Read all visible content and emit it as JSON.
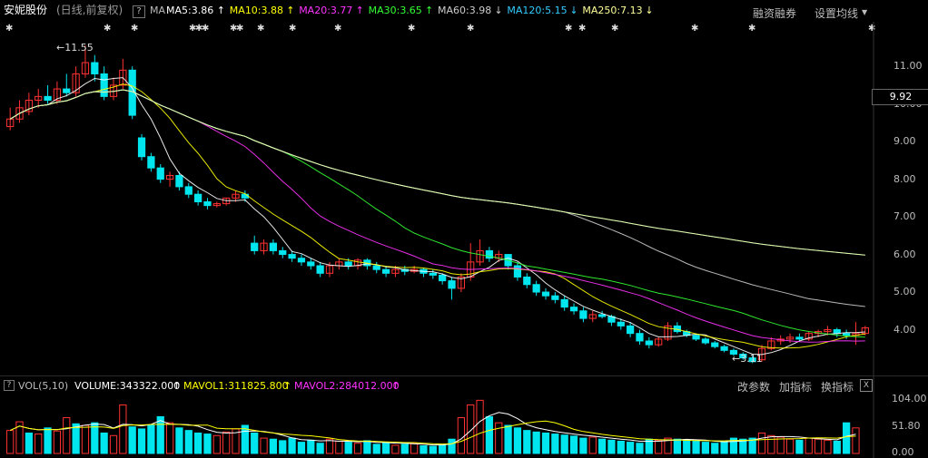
{
  "header": {
    "stock_name": "安妮股份",
    "mode": "(日线,前复权)",
    "help_icon": "?",
    "ma_label": "MA",
    "ma_items": [
      {
        "label": "MA5:3.86",
        "arrow": "↑",
        "color": "#ffffff"
      },
      {
        "label": "MA10:3.88",
        "arrow": "↑",
        "color": "#ffff00"
      },
      {
        "label": "MA20:3.77",
        "arrow": "↑",
        "color": "#ff33ff"
      },
      {
        "label": "MA30:3.65",
        "arrow": "↑",
        "color": "#33ff33"
      },
      {
        "label": "MA60:3.98",
        "arrow": "↓",
        "color": "#cccccc"
      },
      {
        "label": "MA120:5.15",
        "arrow": "↓",
        "color": "#33ccff"
      },
      {
        "label": "MA250:7.13",
        "arrow": "↓",
        "color": "#ffff99"
      }
    ],
    "btn_margin": "融资融券",
    "btn_settings": "设置均线"
  },
  "price_panel": {
    "current_price": "9.92",
    "high_label": "11.55",
    "low_label": "3.11",
    "y_ticks": [
      "11.00",
      "10.00",
      "9.00",
      "8.00",
      "7.00",
      "6.00",
      "5.00",
      "4.00"
    ]
  },
  "volume_panel": {
    "vol_label": "VOL(5,10)",
    "volume": "VOLUME:343322.000",
    "mavol1": "MAVOL1:311825.800",
    "mavol2": "MAVOL2:284012.000",
    "btn_params": "改参数",
    "btn_add": "加指标",
    "btn_switch": "换指标",
    "close_icon": "X",
    "y_ticks": [
      "104.00",
      "51.80",
      "0.00"
    ],
    "y_unit": "万"
  },
  "colors": {
    "up": "#ff3232",
    "down": "#00e5ee",
    "bg": "#000000"
  },
  "chart_data": {
    "type": "candlestick",
    "price_ylim": [
      3.0,
      11.8
    ],
    "volume_ylim": [
      0,
      110
    ],
    "candles": [
      [
        9.4,
        9.9,
        9.6,
        9.3
      ],
      [
        9.6,
        10.1,
        9.9,
        9.5
      ],
      [
        9.8,
        10.3,
        10.1,
        9.7
      ],
      [
        10.1,
        10.4,
        10.2,
        9.9
      ],
      [
        10.2,
        10.5,
        10.1,
        10.0
      ],
      [
        10.1,
        10.6,
        10.4,
        10.0
      ],
      [
        10.4,
        10.8,
        10.3,
        10.2
      ],
      [
        10.3,
        11.0,
        10.8,
        10.2
      ],
      [
        10.8,
        11.55,
        11.1,
        10.7
      ],
      [
        11.1,
        11.3,
        10.8,
        10.6
      ],
      [
        10.8,
        11.0,
        10.2,
        10.1
      ],
      [
        10.2,
        10.7,
        10.5,
        10.1
      ],
      [
        10.5,
        11.2,
        10.9,
        10.4
      ],
      [
        10.9,
        11.0,
        9.7,
        9.6
      ],
      [
        9.1,
        9.2,
        8.6,
        8.5
      ],
      [
        8.6,
        8.7,
        8.3,
        8.2
      ],
      [
        8.3,
        8.4,
        8.0,
        7.9
      ],
      [
        8.0,
        8.2,
        8.1,
        7.8
      ],
      [
        8.1,
        8.2,
        7.8,
        7.7
      ],
      [
        7.8,
        7.9,
        7.6,
        7.5
      ],
      [
        7.6,
        7.7,
        7.4,
        7.3
      ],
      [
        7.4,
        7.5,
        7.3,
        7.2
      ],
      [
        7.3,
        7.4,
        7.35,
        7.25
      ],
      [
        7.35,
        7.5,
        7.5,
        7.3
      ],
      [
        7.5,
        7.7,
        7.6,
        7.4
      ],
      [
        7.6,
        7.7,
        7.5,
        7.4
      ],
      [
        6.3,
        6.5,
        6.1,
        6.0
      ],
      [
        6.1,
        6.4,
        6.3,
        6.0
      ],
      [
        6.3,
        6.4,
        6.1,
        6.0
      ],
      [
        6.1,
        6.2,
        6.0,
        5.9
      ],
      [
        6.0,
        6.1,
        5.9,
        5.8
      ],
      [
        5.9,
        6.0,
        5.8,
        5.7
      ],
      [
        5.8,
        5.9,
        5.7,
        5.6
      ],
      [
        5.7,
        5.8,
        5.5,
        5.4
      ],
      [
        5.5,
        5.8,
        5.7,
        5.4
      ],
      [
        5.7,
        5.9,
        5.8,
        5.6
      ],
      [
        5.8,
        5.9,
        5.7,
        5.6
      ],
      [
        5.7,
        5.9,
        5.85,
        5.6
      ],
      [
        5.85,
        5.9,
        5.7,
        5.6
      ],
      [
        5.7,
        5.8,
        5.6,
        5.5
      ],
      [
        5.6,
        5.7,
        5.5,
        5.4
      ],
      [
        5.5,
        5.7,
        5.6,
        5.4
      ],
      [
        5.6,
        5.7,
        5.55,
        5.45
      ],
      [
        5.55,
        5.7,
        5.6,
        5.5
      ],
      [
        5.6,
        5.65,
        5.5,
        5.4
      ],
      [
        5.5,
        5.6,
        5.45,
        5.35
      ],
      [
        5.45,
        5.5,
        5.3,
        5.2
      ],
      [
        5.3,
        5.4,
        5.1,
        4.8
      ],
      [
        5.1,
        5.5,
        5.4,
        5.0
      ],
      [
        5.4,
        6.3,
        5.8,
        5.3
      ],
      [
        5.8,
        6.4,
        6.1,
        5.7
      ],
      [
        6.1,
        6.2,
        5.9,
        5.8
      ],
      [
        5.9,
        6.1,
        6.0,
        5.8
      ],
      [
        6.0,
        6.0,
        5.7,
        5.6
      ],
      [
        5.7,
        5.8,
        5.4,
        5.3
      ],
      [
        5.4,
        5.5,
        5.2,
        5.1
      ],
      [
        5.2,
        5.3,
        5.0,
        4.9
      ],
      [
        5.0,
        5.1,
        4.9,
        4.8
      ],
      [
        4.9,
        5.0,
        4.8,
        4.7
      ],
      [
        4.8,
        4.9,
        4.6,
        4.5
      ],
      [
        4.6,
        4.7,
        4.5,
        4.4
      ],
      [
        4.5,
        4.6,
        4.3,
        4.2
      ],
      [
        4.3,
        4.5,
        4.4,
        4.2
      ],
      [
        4.4,
        4.5,
        4.35,
        4.3
      ],
      [
        4.35,
        4.4,
        4.2,
        4.1
      ],
      [
        4.2,
        4.3,
        4.1,
        4.0
      ],
      [
        4.1,
        4.2,
        3.9,
        3.8
      ],
      [
        3.9,
        4.0,
        3.7,
        3.6
      ],
      [
        3.7,
        3.8,
        3.6,
        3.5
      ],
      [
        3.6,
        3.8,
        3.75,
        3.55
      ],
      [
        3.75,
        4.2,
        4.1,
        3.7
      ],
      [
        4.1,
        4.2,
        3.95,
        3.9
      ],
      [
        3.95,
        4.0,
        3.85,
        3.8
      ],
      [
        3.85,
        3.9,
        3.75,
        3.7
      ],
      [
        3.75,
        3.8,
        3.65,
        3.6
      ],
      [
        3.65,
        3.7,
        3.55,
        3.5
      ],
      [
        3.55,
        3.6,
        3.45,
        3.4
      ],
      [
        3.45,
        3.5,
        3.35,
        3.3
      ],
      [
        3.35,
        3.4,
        3.25,
        3.2
      ],
      [
        3.25,
        3.3,
        3.15,
        3.11
      ],
      [
        3.2,
        3.6,
        3.5,
        3.15
      ],
      [
        3.5,
        3.8,
        3.7,
        3.45
      ],
      [
        3.7,
        3.85,
        3.75,
        3.6
      ],
      [
        3.75,
        3.9,
        3.8,
        3.65
      ],
      [
        3.8,
        3.9,
        3.75,
        3.7
      ],
      [
        3.75,
        3.95,
        3.9,
        3.7
      ],
      [
        3.9,
        4.0,
        3.95,
        3.8
      ],
      [
        3.95,
        4.1,
        4.0,
        3.85
      ],
      [
        4.0,
        4.05,
        3.9,
        3.8
      ],
      [
        3.9,
        4.0,
        3.85,
        3.75
      ],
      [
        3.85,
        4.2,
        3.9,
        3.6
      ],
      [
        3.9,
        4.1,
        4.05,
        3.85
      ]
    ],
    "volumes": [
      45,
      62,
      40,
      38,
      50,
      44,
      70,
      58,
      55,
      60,
      40,
      35,
      95,
      52,
      48,
      55,
      72,
      60,
      50,
      45,
      40,
      38,
      35,
      42,
      48,
      55,
      40,
      30,
      28,
      25,
      30,
      22,
      26,
      20,
      28,
      24,
      22,
      20,
      25,
      18,
      22,
      16,
      18,
      20,
      15,
      14,
      16,
      28,
      70,
      95,
      104,
      72,
      60,
      55,
      50,
      45,
      42,
      40,
      38,
      36,
      34,
      30,
      32,
      28,
      26,
      24,
      22,
      20,
      28,
      26,
      30,
      28,
      26,
      24,
      22,
      20,
      22,
      30,
      28,
      30,
      40,
      35,
      32,
      28,
      26,
      30,
      28,
      26,
      24,
      60,
      50
    ],
    "volume_colors": [
      "up",
      "up",
      "down",
      "up",
      "down",
      "up",
      "up",
      "down",
      "up",
      "down",
      "down",
      "up",
      "up",
      "down",
      "down",
      "down",
      "down",
      "up",
      "down",
      "down",
      "down",
      "down",
      "up",
      "up",
      "up",
      "down",
      "down",
      "up",
      "down",
      "down",
      "down",
      "down",
      "down",
      "down",
      "up",
      "up",
      "down",
      "up",
      "down",
      "down",
      "down",
      "up",
      "down",
      "up",
      "down",
      "down",
      "down",
      "down",
      "up",
      "up",
      "up",
      "down",
      "up",
      "down",
      "down",
      "down",
      "down",
      "down",
      "down",
      "down",
      "down",
      "down",
      "up",
      "down",
      "down",
      "down",
      "down",
      "down",
      "down",
      "up",
      "up",
      "down",
      "down",
      "down",
      "down",
      "down",
      "down",
      "down",
      "down",
      "down",
      "up",
      "up",
      "up",
      "up",
      "down",
      "up",
      "up",
      "up",
      "down",
      "down",
      "up",
      "up"
    ]
  }
}
